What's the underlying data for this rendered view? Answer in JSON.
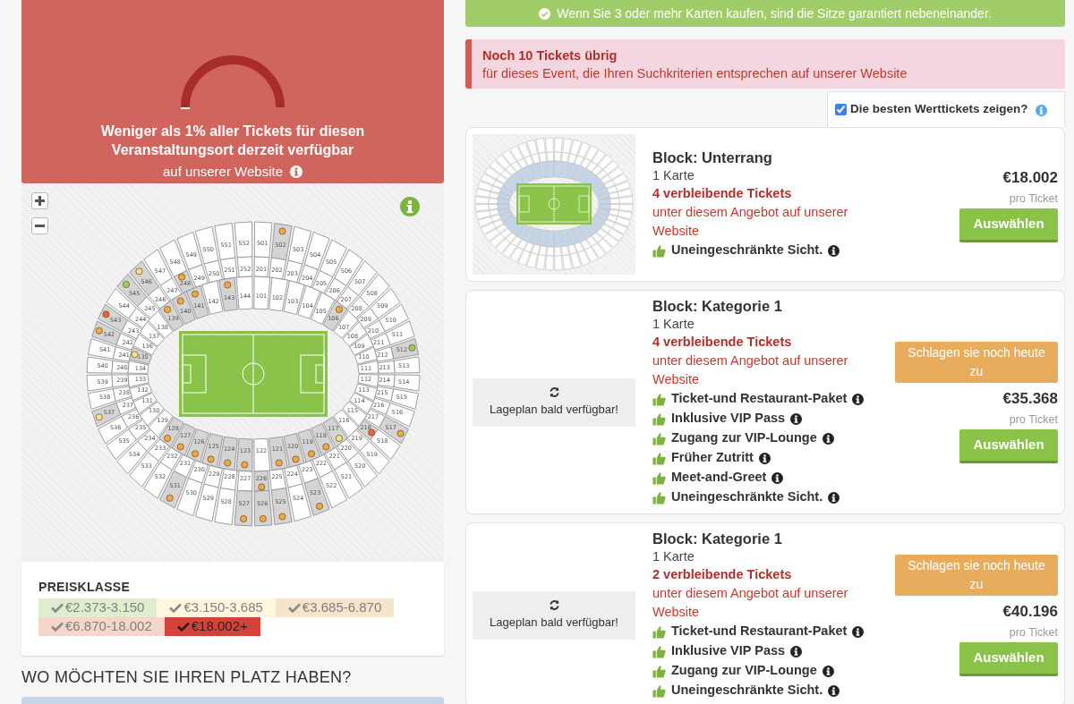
{
  "top_banner": {
    "text": "Wenn Sie 3 oder mehr Karten kaufen, sind die Sitze garantiert nebeneinander."
  },
  "availability": {
    "headline": "Weniger als 1% aller Tickets für diesen Veranstaltungsort derzeit verfügbar",
    "subline": "auf unserer Website"
  },
  "map": {
    "outer_ring": {
      "upper": [
        {
          "label": "540"
        },
        {
          "label": "541"
        },
        {
          "label": "542",
          "color": "#f0a848"
        },
        {
          "label": "543",
          "color": "#e8643c"
        },
        {
          "label": "544"
        },
        {
          "label": "545",
          "color": "#9bcf5a"
        },
        {
          "label": "546",
          "color": "#f3e08a"
        },
        {
          "label": "547"
        },
        {
          "label": "548"
        },
        {
          "label": "549"
        },
        {
          "label": "550"
        },
        {
          "label": "551"
        },
        {
          "label": "552"
        },
        {
          "label": "501"
        },
        {
          "label": "502",
          "color": "#f0a848"
        },
        {
          "label": "503"
        },
        {
          "label": "504"
        },
        {
          "label": "505"
        },
        {
          "label": "506"
        },
        {
          "label": "507"
        },
        {
          "label": "508"
        },
        {
          "label": "509"
        },
        {
          "label": "510"
        },
        {
          "label": "511"
        },
        {
          "label": "512",
          "color": "#9bcf5a"
        },
        {
          "label": "513"
        }
      ],
      "lower": [
        {
          "label": "539"
        },
        {
          "label": "538"
        },
        {
          "label": "537",
          "color": "#f3e08a"
        },
        {
          "label": "536"
        },
        {
          "label": "535"
        },
        {
          "label": "534"
        },
        {
          "label": "533"
        },
        {
          "label": "532"
        },
        {
          "label": "531",
          "color": "#f0a848"
        },
        {
          "label": "530"
        },
        {
          "label": "529"
        },
        {
          "label": "528"
        },
        {
          "label": "527",
          "color": "#f0a848"
        },
        {
          "label": "526",
          "color": "#f0a848"
        },
        {
          "label": "525",
          "color": "#f0a848"
        },
        {
          "label": "524"
        },
        {
          "label": "523",
          "color": "#f0a848"
        },
        {
          "label": "522"
        },
        {
          "label": "521"
        },
        {
          "label": "520"
        },
        {
          "label": "519"
        },
        {
          "label": "518"
        },
        {
          "label": "517",
          "color": "#f0a848"
        },
        {
          "label": "516"
        },
        {
          "label": "515"
        },
        {
          "label": "514"
        }
      ]
    },
    "middle_ring": {
      "upper": [
        {
          "label": "240"
        },
        {
          "label": "241"
        },
        {
          "label": "242"
        },
        {
          "label": "243"
        },
        {
          "label": "244"
        },
        {
          "label": "245"
        },
        {
          "label": "246"
        },
        {
          "label": "247"
        },
        {
          "label": "248",
          "color": "#f0a848"
        },
        {
          "label": "249"
        },
        {
          "label": "250"
        },
        {
          "label": "251"
        },
        {
          "label": "252"
        },
        {
          "label": "201"
        },
        {
          "label": "202"
        },
        {
          "label": "203"
        },
        {
          "label": "204"
        },
        {
          "label": "205"
        },
        {
          "label": "206"
        },
        {
          "label": "207"
        },
        {
          "label": "208"
        },
        {
          "label": "209"
        },
        {
          "label": "210"
        },
        {
          "label": "211"
        },
        {
          "label": "212"
        },
        {
          "label": "213"
        }
      ],
      "lower": [
        {
          "label": "239"
        },
        {
          "label": "238"
        },
        {
          "label": "237"
        },
        {
          "label": "236"
        },
        {
          "label": "235"
        },
        {
          "label": "234"
        },
        {
          "label": "233"
        },
        {
          "label": "232"
        },
        {
          "label": "231"
        },
        {
          "label": "230"
        },
        {
          "label": "229"
        },
        {
          "label": "228"
        },
        {
          "label": "227"
        },
        {
          "label": "226",
          "color": "#f0a848"
        },
        {
          "label": "225"
        },
        {
          "label": "224"
        },
        {
          "label": "223"
        },
        {
          "label": "222"
        },
        {
          "label": "221"
        },
        {
          "label": "220"
        },
        {
          "label": "219"
        },
        {
          "label": "218",
          "color": "#e8643c"
        },
        {
          "label": "217"
        },
        {
          "label": "216"
        },
        {
          "label": "215"
        },
        {
          "label": "214"
        }
      ]
    },
    "inner_ring": {
      "upper": [
        {
          "label": "134"
        },
        {
          "label": "135",
          "color": "#f3e08a"
        },
        {
          "label": "136"
        },
        {
          "label": "137"
        },
        {
          "label": "138"
        },
        {
          "label": "139",
          "color": "#f0a848"
        },
        {
          "label": "140",
          "color": "#f0a848"
        },
        {
          "label": "141",
          "color": "#f0a848"
        },
        {
          "label": "142"
        },
        {
          "label": "143",
          "color": "#f0a848"
        },
        {
          "label": "144"
        },
        {
          "label": "101"
        },
        {
          "label": "102"
        },
        {
          "label": "103"
        },
        {
          "label": "104"
        },
        {
          "label": "105"
        },
        {
          "label": "106",
          "color": "#f0a848"
        },
        {
          "label": "107"
        },
        {
          "label": "108"
        },
        {
          "label": "109"
        },
        {
          "label": "110"
        },
        {
          "label": "111"
        }
      ],
      "lower": [
        {
          "label": "133"
        },
        {
          "label": "132"
        },
        {
          "label": "131"
        },
        {
          "label": "130"
        },
        {
          "label": "129"
        },
        {
          "label": "128",
          "color": "#f0a848"
        },
        {
          "label": "127",
          "color": "#f0a848"
        },
        {
          "label": "126",
          "color": "#f0a848"
        },
        {
          "label": "125",
          "color": "#f0a848"
        },
        {
          "label": "124",
          "color": "#f0a848"
        },
        {
          "label": "123",
          "color": "#f0a848"
        },
        {
          "label": "122"
        },
        {
          "label": "121",
          "color": "#f0a848"
        },
        {
          "label": "120",
          "color": "#f0a848"
        },
        {
          "label": "119",
          "color": "#f0a848"
        },
        {
          "label": "118",
          "color": "#f0a848"
        },
        {
          "label": "117",
          "color": "#f3e08a"
        },
        {
          "label": "116"
        },
        {
          "label": "115"
        },
        {
          "label": "114"
        },
        {
          "label": "113"
        },
        {
          "label": "112"
        }
      ]
    }
  },
  "price_legend": {
    "title": "PREISKLASSE",
    "items": [
      {
        "label": "€2.373-3.150",
        "color": "#deedcd",
        "selected": false
      },
      {
        "label": "€3.150-3.685",
        "color": "#fdf7e0",
        "selected": false
      },
      {
        "label": "€3.685-6.870",
        "color": "#f6e4cb",
        "selected": false
      },
      {
        "label": "€6.870-18.002",
        "color": "#f5d6c9",
        "selected": false
      },
      {
        "label": "€18.002+",
        "color": "#d2443a",
        "selected": true
      }
    ]
  },
  "seat_heading": "WO MÖCHTEN SIE IHREN PLATZ HABEN?",
  "alert": {
    "title": "Noch 10 Tickets übrig",
    "text": "für dieses Event, die Ihren Suchkriterien entsprechen auf unserer Website"
  },
  "best_value": {
    "label": "Die besten Werttickets zeigen?",
    "checked": true
  },
  "listings": [
    {
      "image": {
        "kind": "stadium"
      },
      "block": "Block: Unterrang",
      "quantity": "1 Karte",
      "remaining": "4 verbleibende Tickets",
      "remaining_note": "unter diesem Angebot auf unserer Website",
      "features": [
        "Uneingeschränkte Sicht."
      ],
      "price": "€18.002",
      "price_unit": "pro Ticket",
      "button": "Auswählen"
    },
    {
      "image": {
        "kind": "placeholder",
        "text": "Lageplan bald verfügbar!"
      },
      "block": "Block: Kategorie 1",
      "quantity": "1 Karte",
      "remaining": "4 verbleibende Tickets",
      "remaining_note": "unter diesem Angebot auf unserer Website",
      "features": [
        "Ticket-und Restaurant-Paket",
        "Inklusive VIP Pass",
        "Zugang zur VIP-Lounge",
        "Früher Zutritt",
        "Meet-and-Greet",
        "Uneingeschränkte Sicht."
      ],
      "badge": "Schlagen sie noch heute zu",
      "price": "€35.368",
      "price_unit": "pro Ticket",
      "button": "Auswählen"
    },
    {
      "image": {
        "kind": "placeholder",
        "text": "Lageplan bald verfügbar!"
      },
      "block": "Block: Kategorie 1",
      "quantity": "1 Karte",
      "remaining": "2 verbleibende Tickets",
      "remaining_note": "unter diesem Angebot auf unserer Website",
      "features": [
        "Ticket-und Restaurant-Paket",
        "Inklusive VIP Pass",
        "Zugang zur VIP-Lounge",
        "Uneingeschränkte Sicht."
      ],
      "badge": "Schlagen sie noch heute zu",
      "price": "€40.196",
      "price_unit": "pro Ticket",
      "button": "Auswählen"
    }
  ]
}
